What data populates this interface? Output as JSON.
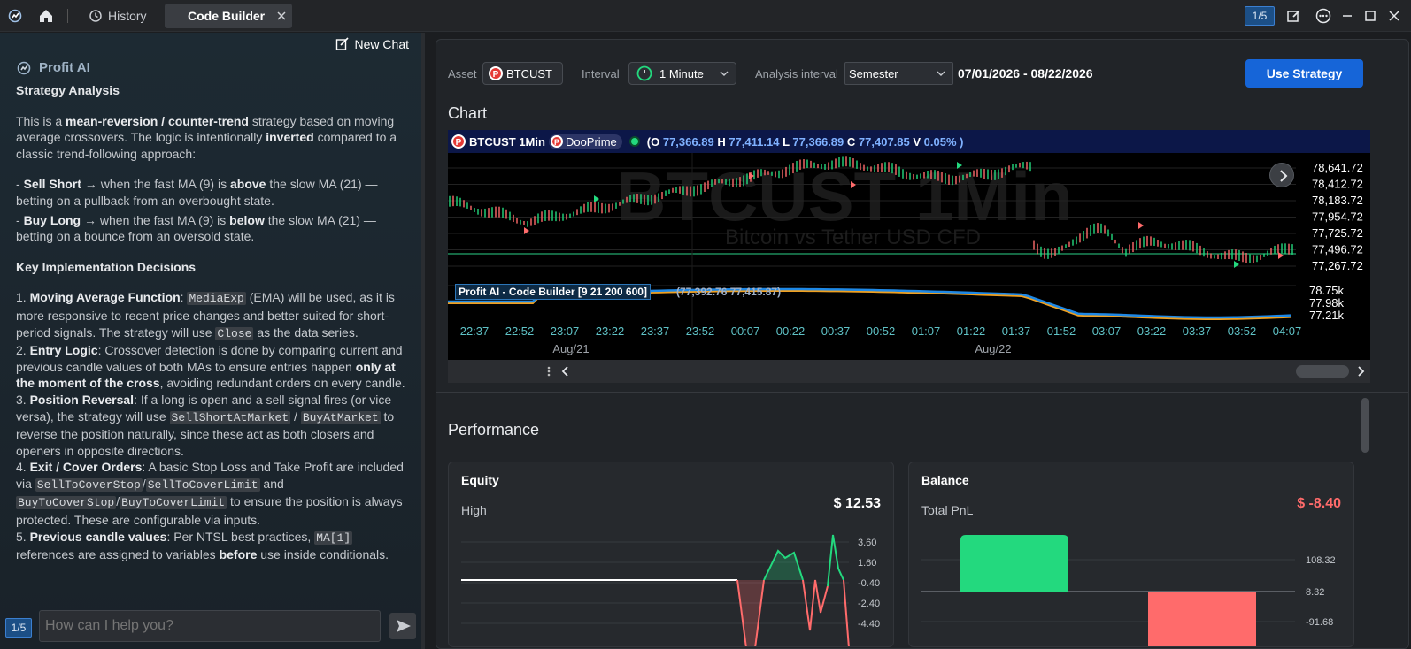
{
  "titlebar": {
    "tabs": [
      {
        "label": "History"
      },
      {
        "label": "Code Builder"
      }
    ],
    "page_badge": "1/5"
  },
  "chat": {
    "new_chat": "New Chat",
    "assistant": "Profit AI",
    "heading": "Strategy Analysis",
    "intro_a": "This is a ",
    "intro_b": "mean-reversion / counter-trend",
    "intro_c": " strategy based on moving average crossovers. The logic is intentionally ",
    "intro_d": "inverted",
    "intro_e": " compared to a classic trend-following approach:",
    "ss_a": "Sell Short",
    "ss_b": " → when the fast MA (9) is ",
    "ss_c": "above",
    "ss_d": " the slow MA (21) — betting on a pullback from an overbought state.",
    "bl_a": "Buy Long",
    "bl_b": " → when the fast MA (9) is ",
    "bl_c": "below",
    "bl_d": " the slow MA (21) — betting on a bounce from an oversold state.",
    "decisions_heading": "Key Implementation Decisions",
    "d1_a": "1. ",
    "d1_b": "Moving Average Function",
    "d1_c": ": ",
    "d1_code1": "MediaExp",
    "d1_d": " (EMA) will be used, as it is more responsive to recent price changes and better suited for short-period signals. The strategy will use ",
    "d1_code2": "Close",
    "d1_e": " as the data series.",
    "d2_a": "2. ",
    "d2_b": "Entry Logic",
    "d2_c": ": Crossover detection is done by comparing current and previous candle values of both MAs to ensure entries happen ",
    "d2_d": "only at the moment of the cross",
    "d2_e": ", avoiding redundant orders on every candle.",
    "d3_a": "3. ",
    "d3_b": "Position Reversal",
    "d3_c": ": If a long is open and a sell signal fires (or vice versa), the strategy will use ",
    "d3_code1": "SellShortAtMarket",
    "d3_d": " / ",
    "d3_code2": "BuyAtMarket",
    "d3_e": " to reverse the position naturally, since these act as both closers and openers in opposite directions.",
    "d4_a": "4. ",
    "d4_b": "Exit / Cover Orders",
    "d4_c": ": A basic Stop Loss and Take Profit are included via ",
    "d4_code1": "SellToCoverStop",
    "d4_s1": "/",
    "d4_code2": "SellToCoverLimit",
    "d4_d": " and ",
    "d4_code3": "BuyToCoverStop",
    "d4_s2": "/",
    "d4_code4": "BuyToCoverLimit",
    "d4_e": " to ensure the position is always protected. These are configurable via inputs.",
    "d5_a": "5. ",
    "d5_b": "Previous candle values",
    "d5_c": ": Per NTSL best practices, ",
    "d5_code": "MA[1]",
    "d5_d": " references are assigned to variables ",
    "d5_e": "before",
    "d5_f": " use inside conditionals.",
    "input_placeholder": "How can I help you?",
    "input_badge": "1/5"
  },
  "toolbar": {
    "asset_label": "Asset",
    "asset": "BTCUST",
    "interval_label": "Interval",
    "interval": "1 Minute",
    "analysis_label": "Analysis interval",
    "analysis": "Semester",
    "date_range": "07/01/2026 - 08/22/2026",
    "use_strategy": "Use Strategy"
  },
  "chart": {
    "section_title": "Chart",
    "symbol": "BTCUST 1Min",
    "broker": "DooPrime",
    "o_label": "O",
    "o": "77,366.89",
    "h_label": "H",
    "h": "77,411.14",
    "l_label": "L",
    "l": "77,366.89",
    "c_label": "C",
    "c": "77,407.85",
    "v_label": "V",
    "v": "0.05% )",
    "ohlc_open": "(",
    "watermark": "BTCUST 1Min",
    "watermark_sub": "Bitcoin vs Tether USD CFD",
    "price_ticks": [
      "78,641.72",
      "78,412.72",
      "78,183.72",
      "77,954.72",
      "77,725.72",
      "77,496.72",
      "77,267.72"
    ],
    "indicator_label": "Profit AI - Code Builder [9 21 200 600]",
    "indicator_values": "(77,392.76 77,415.87)",
    "indicator_ticks": [
      "78.75k",
      "77.98k",
      "77.21k"
    ],
    "time_ticks": [
      "22:37",
      "22:52",
      "23:07",
      "23:22",
      "23:37",
      "23:52",
      "00:07",
      "00:22",
      "00:37",
      "00:52",
      "01:07",
      "01:22",
      "01:37",
      "01:52",
      "03:07",
      "03:22",
      "03:37",
      "03:52",
      "04:07"
    ],
    "date_ticks": [
      "Aug/21",
      "Aug/22"
    ]
  },
  "performance": {
    "title": "Performance",
    "equity": {
      "title": "Equity",
      "metric_label": "High",
      "metric_value": "$ 12.53",
      "ticks": [
        "3.60",
        "1.60",
        "-0.40",
        "-2.40",
        "-4.40"
      ]
    },
    "balance": {
      "title": "Balance",
      "metric_label": "Total PnL",
      "metric_value": "$ -8.40",
      "ticks": [
        "108.32",
        "8.32",
        "-91.68"
      ]
    }
  },
  "colors": {
    "accent": "#1665d8",
    "up": "#23d97e",
    "down": "#ff6b6b",
    "ma_fast": "#1e88e5",
    "ma_slow": "#f0a020"
  }
}
